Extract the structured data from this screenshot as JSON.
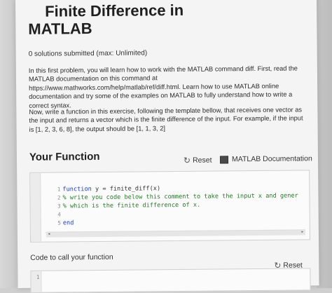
{
  "header": {
    "title_line1": "Finite Difference in",
    "title_line2": "MATLAB",
    "subtitle": "0 solutions submitted (max: Unlimited)"
  },
  "description": {
    "para1": "In this first problem, you will learn how to work with the MATLAB command diff. First, read the MATLAB documentation on this command at https://www.mathworks.com/help/matlab/ref/diff.html. Learn how to use MATLAB online documentation and try some of the examples on MATLAB to fully understand how to write a correct syntax.",
    "para2": "Now, write a function in this exercise, following the template bellow, that receives one vector as the input and returns a vector which is the finite difference of the input. For example, if the input is [1, 2, 3, 6, 8], the output should be [1, 1, 3, 2]"
  },
  "your_function": {
    "title": "Your Function",
    "reset_label": "Reset",
    "reset_icon": "refresh-icon",
    "doc_label": "MATLAB Documentation",
    "doc_icon": "documentation-icon"
  },
  "editor": {
    "lines": [
      {
        "num": "1",
        "kw": "function",
        "rest": " y = finite_diff(x)",
        "comment": ""
      },
      {
        "num": "2",
        "kw": "",
        "rest": "",
        "comment": "% write you code below this comment to take the input x and gener"
      },
      {
        "num": "3",
        "kw": "",
        "rest": "",
        "comment": "% which is the finite difference of x."
      },
      {
        "num": "4",
        "kw": "",
        "rest": "",
        "comment": ""
      },
      {
        "num": "5",
        "kw": "end",
        "rest": "",
        "comment": ""
      }
    ],
    "scroll_left": "◂",
    "scroll_right": "▸"
  },
  "call_section": {
    "title": "Code to call your function",
    "reset_label": "Reset",
    "reset_icon": "refresh-icon",
    "line_num": "1"
  }
}
